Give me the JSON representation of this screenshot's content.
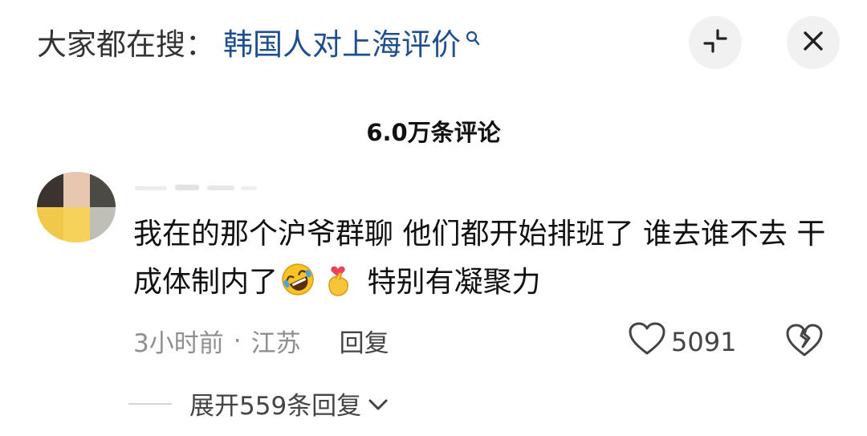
{
  "search": {
    "prefix": "大家都在搜：",
    "query": "韩国人对上海评价"
  },
  "header": {
    "comment_count": "6.0万条评论"
  },
  "comment": {
    "text_before_emoji": "我在的那个沪爷群聊 他们都开始排班了 谁去谁不去 干成体制内了",
    "emojis": [
      "rofl-emoji",
      "finger-heart-emoji"
    ],
    "text_after_emoji": " 特别有凝聚力",
    "time": "3小时前",
    "separator": "·",
    "location": "江苏",
    "reply_label": "回复",
    "like_count": "5091"
  },
  "replies": {
    "expand_label": "展开559条回复"
  },
  "icons": [
    "search-icon",
    "collapse-icon",
    "close-icon",
    "heart-icon",
    "broken-heart-icon",
    "chevron-down-icon"
  ],
  "colors": {
    "query_blue": "#1f4e8f",
    "meta_gray": "#8f8f8f",
    "button_bg": "#f1f1f1"
  }
}
